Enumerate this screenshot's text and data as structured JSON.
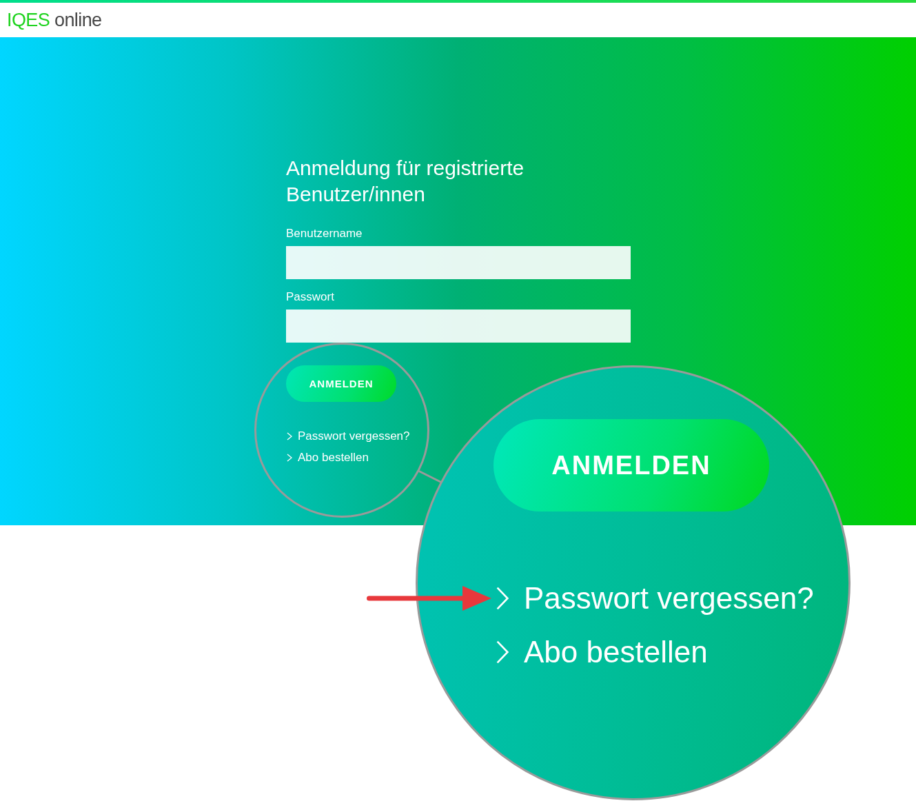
{
  "header": {
    "logo": {
      "brand": "IQES",
      "suffix": "online"
    }
  },
  "login": {
    "title": "Anmeldung für registrierte Benutzer/innen",
    "fields": [
      {
        "label": "Benutzername"
      },
      {
        "label": "Passwort"
      }
    ],
    "submit": "ANMELDEN",
    "links": [
      "Passwort vergessen?",
      "Abo bestellen"
    ]
  },
  "magnifier": {
    "submit": "ANMELDEN",
    "links": [
      "Passwort vergessen?",
      "Abo bestellen"
    ]
  }
}
